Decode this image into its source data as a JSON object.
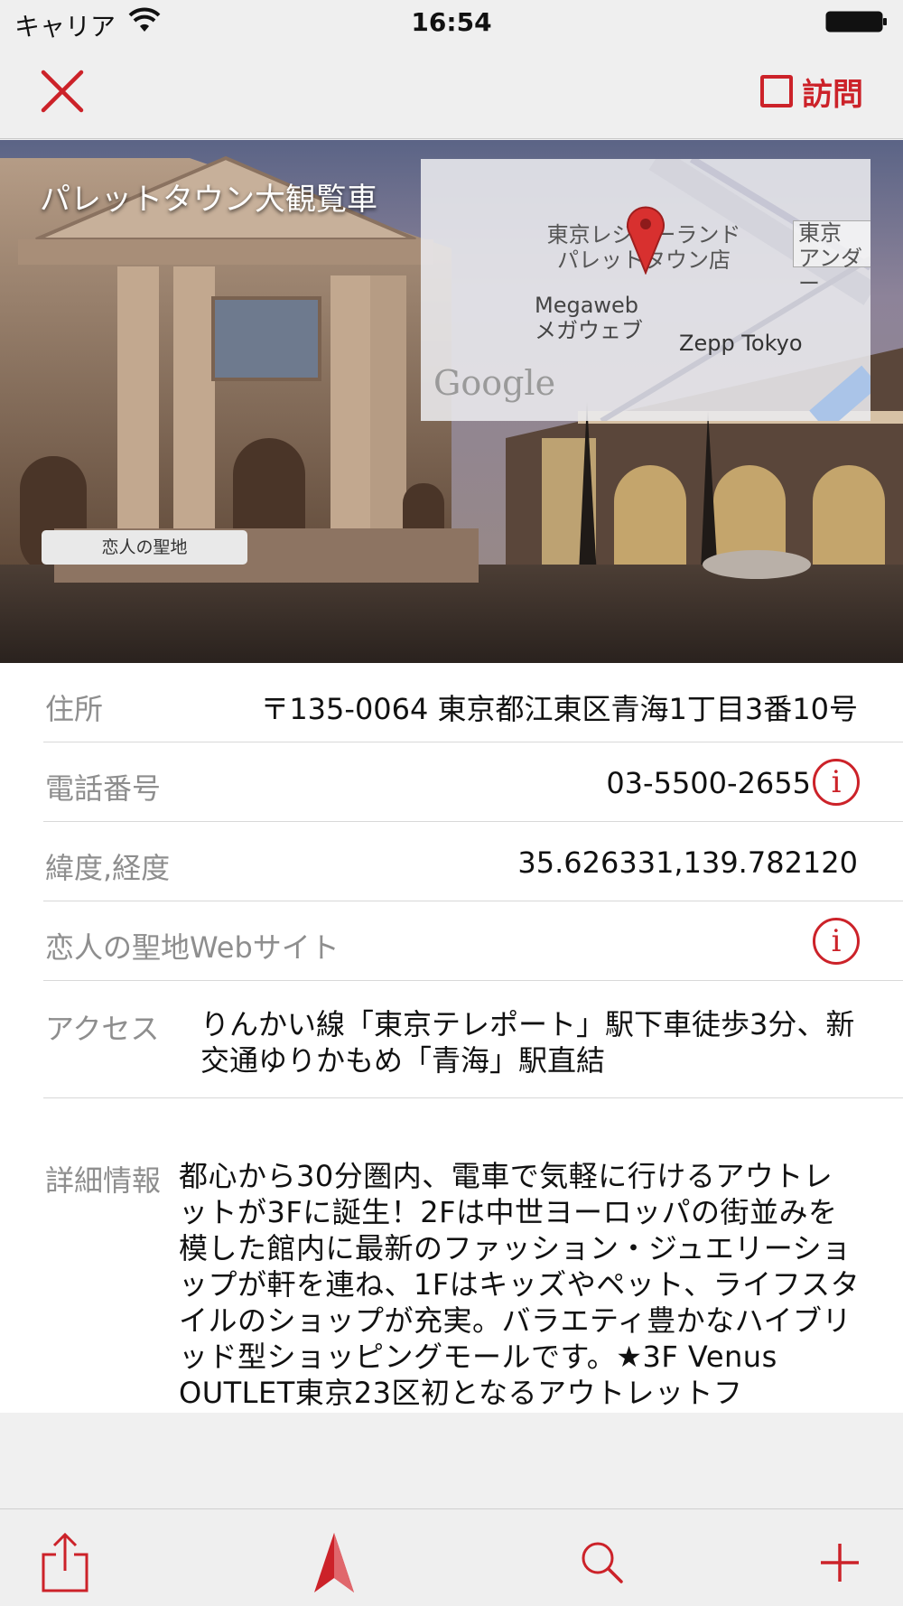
{
  "status_bar": {
    "carrier": "キャリア",
    "time": "16:54"
  },
  "nav": {
    "visit_label": "訪問"
  },
  "hero": {
    "title": "パレットタウン大観覧車",
    "badge": "恋人の聖地",
    "map": {
      "label_1": "東京レジャーランド\nパレットタウン店",
      "label_2": "Megaweb\nメガウェブ",
      "label_3": "Zepp Tokyo",
      "label_4": "東京\nアンダー",
      "attribution": "Google"
    }
  },
  "info": {
    "address": {
      "label": "住所",
      "value": "〒135-0064 東京都江東区青海1丁目3番10号"
    },
    "phone": {
      "label": "電話番号",
      "value": "03-5500-2655"
    },
    "latlng": {
      "label": "緯度,経度",
      "value": "35.626331,139.782120"
    },
    "website": {
      "label": "恋人の聖地Webサイト"
    },
    "access": {
      "label": "アクセス",
      "value": "りんかい線「東京テレポート」駅下車徒歩3分、新交通ゆりかもめ「青海」駅直結"
    },
    "detail": {
      "label": "詳細情報",
      "value": "都心から30分圏内、電車で気軽に行けるアウトレットが3Fに誕生！2Fは中世ヨーロッパの街並みを模した館内に最新のファッション・ジュエリーショップが軒を連ね、1Fはキッズやペット、ライフスタイルのショップが充実。バラエティ豊かなハイブリッド型ショッピングモールです。★3F Venus OUTLET東京23区初となるアウトレットフ"
    }
  },
  "colors": {
    "accent": "#cc2229"
  },
  "icons": [
    "close-icon",
    "checkbox-icon",
    "info-icon",
    "share-icon",
    "navigate-icon",
    "search-icon",
    "add-icon"
  ]
}
